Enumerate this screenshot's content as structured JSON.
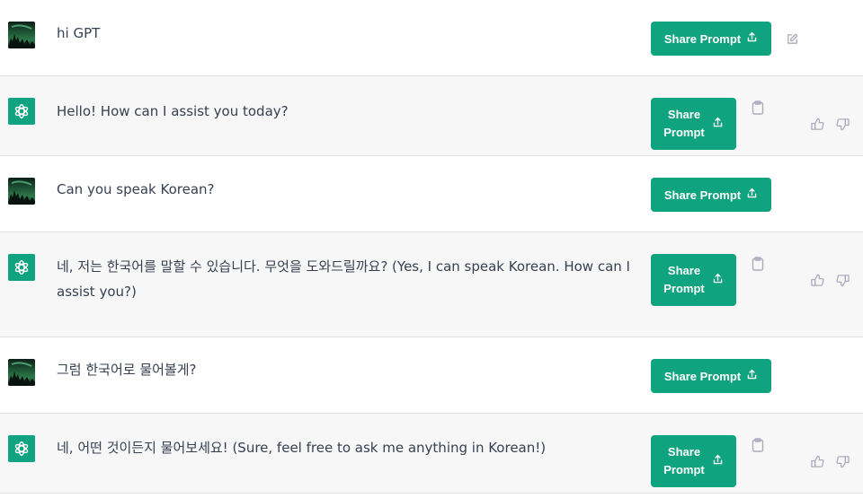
{
  "conversation": [
    {
      "role": "user",
      "avatar_icon": "user-avatar-aurora-icon",
      "text": "hi GPT",
      "share_label": "Share Prompt",
      "action_icon": "edit-icon"
    },
    {
      "role": "assistant",
      "avatar_icon": "openai-logo-icon",
      "text": "Hello! How can I assist you today?",
      "share_label_line1": "Share",
      "share_label_line2": "Prompt",
      "action_icons": [
        "clipboard-icon",
        "thumbs-up-icon",
        "thumbs-down-icon"
      ]
    },
    {
      "role": "user",
      "avatar_icon": "user-avatar-aurora-icon",
      "text": "Can you speak Korean?",
      "share_label": "Share Prompt"
    },
    {
      "role": "assistant",
      "avatar_icon": "openai-logo-icon",
      "text": "네, 저는 한국어를 말할 수 있습니다. 무엇을 도와드릴까요? (Yes, I can speak Korean. How can I assist you?)",
      "share_label_line1": "Share",
      "share_label_line2": "Prompt",
      "action_icons": [
        "clipboard-icon",
        "thumbs-up-icon",
        "thumbs-down-icon"
      ]
    },
    {
      "role": "user",
      "avatar_icon": "user-avatar-aurora-icon",
      "text": "그럼 한국어로 물어볼게?",
      "share_label": "Share Prompt"
    },
    {
      "role": "assistant",
      "avatar_icon": "openai-logo-icon",
      "text": "네, 어떤 것이든지 물어보세요! (Sure, feel free to ask me anything in Korean!)",
      "share_label_line1": "Share",
      "share_label_line2": "Prompt",
      "action_icons": [
        "clipboard-icon",
        "thumbs-up-icon",
        "thumbs-down-icon"
      ]
    }
  ],
  "colors": {
    "accent": "#10a37f",
    "assistant_bg": "#f7f7f8",
    "user_bg": "#ffffff",
    "text": "#374151",
    "icon_gray": "#acacbe"
  }
}
